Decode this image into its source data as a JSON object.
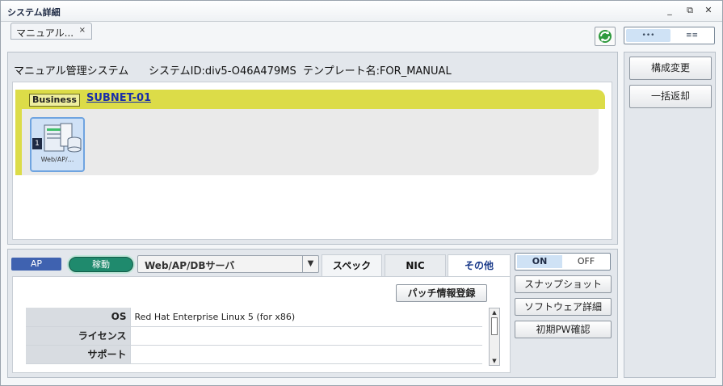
{
  "window": {
    "title": "システム詳細",
    "controls": {
      "minimize": "_",
      "restore": "⧉",
      "close": "✕"
    }
  },
  "doc_tab": {
    "label": "マニュアル...",
    "close": "×"
  },
  "view_toggle": {
    "option_a": "•••",
    "option_b": "≡≡"
  },
  "header": {
    "system_name": "マニュアル管理システム",
    "system_id": "システムID:div5-O46A479MS",
    "template": "テンプレート名:FOR_MANUAL"
  },
  "subnet": {
    "group_label": "Business",
    "name": "SUBNET-01",
    "server": {
      "count": "1",
      "label": "Web/AP/..."
    }
  },
  "detail": {
    "tier_badge": "AP",
    "status": "稼動",
    "server_select": "Web/AP/DBサーバ",
    "tabs": {
      "spec": "スペック",
      "nic": "NIC",
      "other": "その他"
    },
    "patch_button": "パッチ情報登録",
    "rows": [
      {
        "key": "OS",
        "value": "Red Hat Enterprise Linux 5 (for x86)"
      },
      {
        "key": "ライセンス",
        "value": ""
      },
      {
        "key": "サポート",
        "value": ""
      }
    ]
  },
  "power": {
    "on": "ON",
    "off": "OFF"
  },
  "side_buttons": {
    "snapshot": "スナップショット",
    "software_detail": "ソフトウェア詳細",
    "initial_pw": "初期PW確認"
  },
  "right_panel": {
    "config_change": "構成変更",
    "bulk_return": "一括返却"
  },
  "colors": {
    "subnet_band": "#dcdc48",
    "status_green": "#1f8a6d",
    "ap_blue": "#3f62b0",
    "link_blue": "#1a2ea8"
  }
}
